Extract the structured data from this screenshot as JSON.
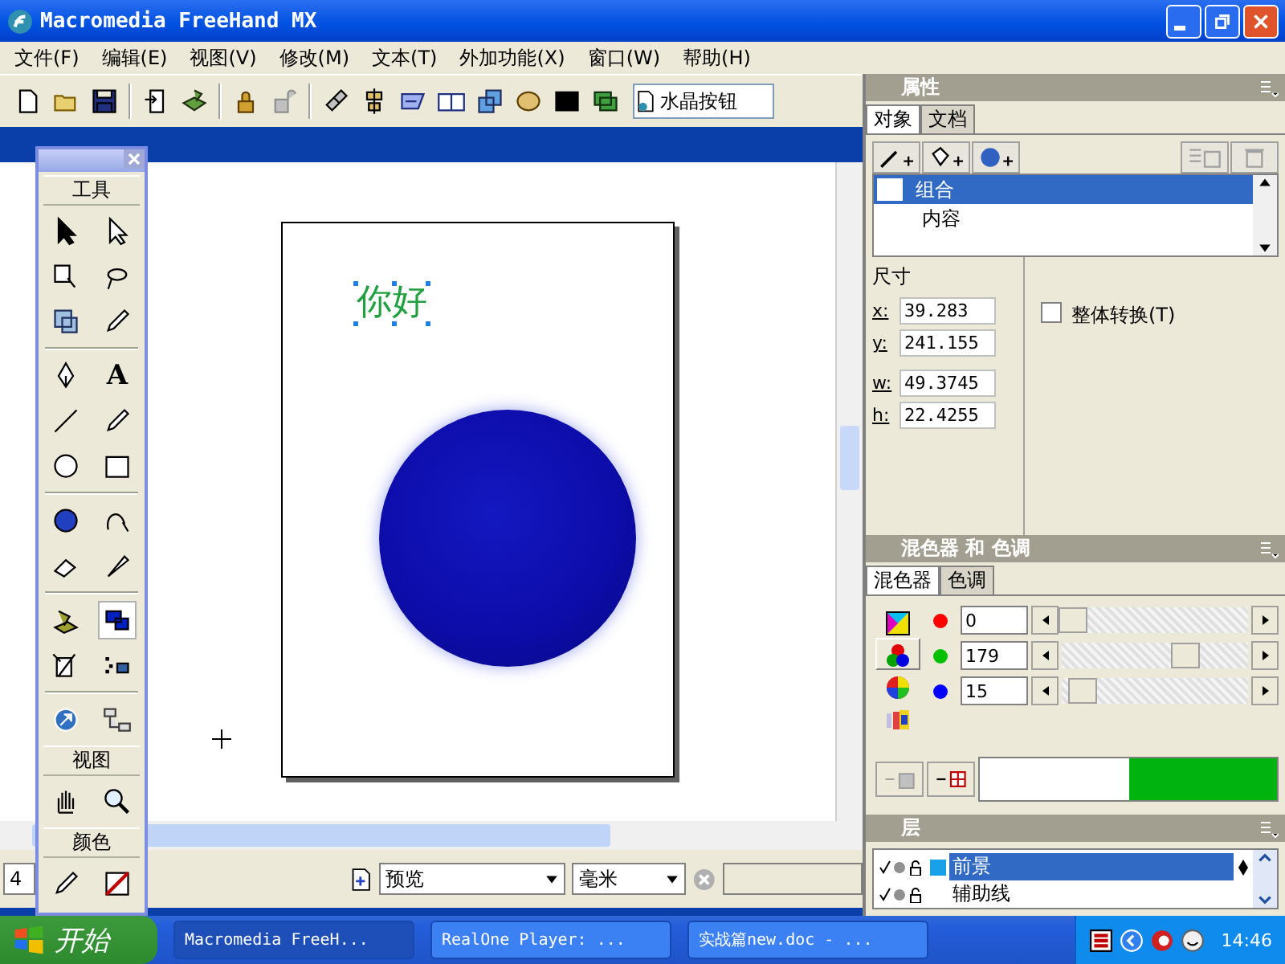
{
  "window": {
    "title": "Macromedia FreeHand MX"
  },
  "menu": [
    "文件(F)",
    "编辑(E)",
    "视图(V)",
    "修改(M)",
    "文本(T)",
    "外加功能(X)",
    "窗口(W)",
    "帮助(H)"
  ],
  "toolbar": {
    "style_field": "水晶按钮"
  },
  "toolbox": {
    "title": "工具",
    "text_tool": "A",
    "view_title": "视图",
    "color_title": "颜色"
  },
  "canvas": {
    "text": "你好"
  },
  "status_bar": {
    "zoom": "4",
    "view_mode": "预览",
    "units": "毫米"
  },
  "properties": {
    "title": "属性",
    "tabs": [
      {
        "label": "对象",
        "selected": true
      },
      {
        "label": "文档",
        "selected": false
      }
    ],
    "tree": [
      {
        "label": "组合",
        "selected": true,
        "children": [
          {
            "label": "内容",
            "selected": false
          }
        ]
      }
    ],
    "size_label": "尺寸",
    "fields": [
      {
        "label": "x:",
        "value": "39.283"
      },
      {
        "label": "y:",
        "value": "241.155"
      },
      {
        "label": "w:",
        "value": "49.3745"
      },
      {
        "label": "h:",
        "value": "22.4255"
      }
    ],
    "checkbox": {
      "label": "整体转换(T)",
      "checked": false
    }
  },
  "mixer": {
    "title": "混色器 和 色调",
    "tabs": [
      {
        "label": "混色器",
        "selected": true
      },
      {
        "label": "色调",
        "selected": false
      }
    ],
    "channels": [
      {
        "color": "#ff0000",
        "value": "0",
        "level": 0.0
      },
      {
        "color": "#00c000",
        "value": "179",
        "level": 0.7
      },
      {
        "color": "#0000ff",
        "value": "15",
        "level": 0.06
      }
    ],
    "swatch": {
      "color": "#00b30f"
    }
  },
  "layers": {
    "title": "层",
    "items": [
      {
        "label": "前景",
        "selected": true,
        "color": "#18a0e8"
      },
      {
        "label": "辅助线",
        "selected": false
      }
    ]
  },
  "taskbar": {
    "start": "开始",
    "tasks": [
      {
        "label": "Macromedia FreeH...",
        "selected": true
      },
      {
        "label": "RealOne Player: ...",
        "selected": false
      },
      {
        "label": "实战篇new.doc - ...",
        "selected": false
      }
    ],
    "clock": "14:46"
  }
}
